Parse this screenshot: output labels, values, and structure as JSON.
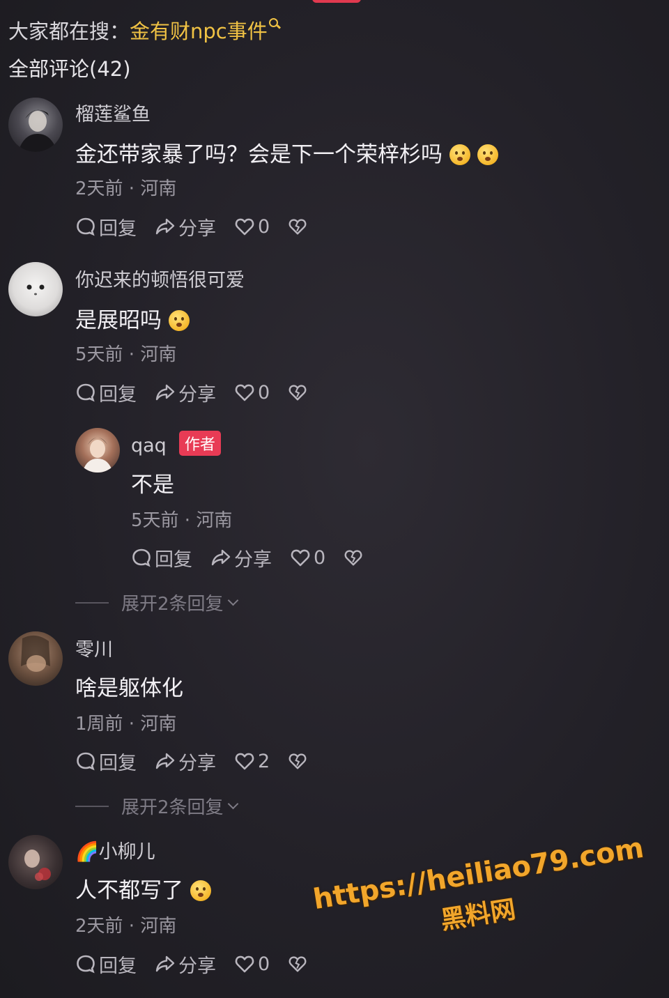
{
  "search_hint": {
    "prefix": "大家都在搜：",
    "keyword": "金有财npc事件"
  },
  "comments_header": "全部评论(42)",
  "comments": [
    {
      "username": "榴莲鲨鱼",
      "content": "金还带家暴了吗？会是下一个荣梓杉吗",
      "time": "2天前",
      "location": "河南",
      "reply": "回复",
      "share": "分享",
      "likes": "0"
    },
    {
      "username": "你迟来的顿悟很可爱",
      "content": "是展昭吗",
      "time": "5天前",
      "location": "河南",
      "reply": "回复",
      "share": "分享",
      "likes": "0"
    },
    {
      "username": "qaq",
      "badge": "作者",
      "content": "不是",
      "time": "5天前",
      "location": "河南",
      "reply": "回复",
      "share": "分享",
      "likes": "0"
    },
    {
      "username": "零川",
      "content": "啥是躯体化",
      "time": "1周前",
      "location": "河南",
      "reply": "回复",
      "share": "分享",
      "likes": "2"
    },
    {
      "username": "🌈小柳儿",
      "content": "人不都写了",
      "time": "2天前",
      "location": "河南",
      "reply": "回复",
      "share": "分享",
      "likes": "0"
    }
  ],
  "expand_replies": [
    "展开2条回复",
    "展开2条回复"
  ],
  "meta_separator": " · ",
  "watermark": {
    "url": "https://heiliao79.com",
    "site": "黑料网"
  },
  "colors": {
    "background": "#232128",
    "keyword": "#f0c244",
    "author_badge": "#e83b55",
    "watermark": "#f2a62b"
  }
}
